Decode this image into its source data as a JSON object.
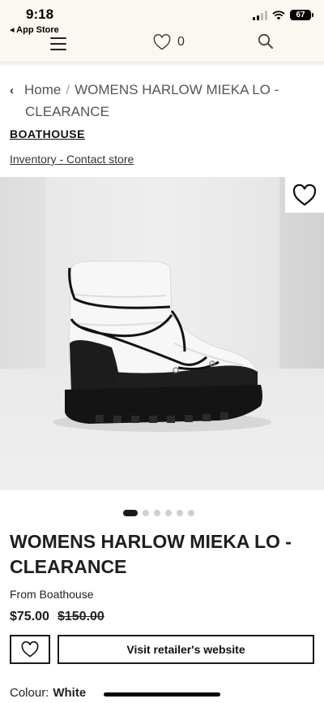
{
  "status_bar": {
    "time": "9:18",
    "back_label": "◂ App Store",
    "battery": "67"
  },
  "header": {
    "menu_icon": "hamburger-menu-icon",
    "wishlist_icon": "heart-icon",
    "wishlist_count": "0",
    "search_icon": "search-icon"
  },
  "breadcrumb": {
    "home": "Home",
    "separator": "/",
    "current_line1": "WOMENS HARLOW MIEKA LO -",
    "current_line2": "CLEARANCE"
  },
  "store": {
    "name": "BOATHOUSE",
    "inventory_link": "Inventory - Contact store"
  },
  "gallery": {
    "image_alt": "White puffer snow boot with black platform sole and black laces",
    "dot_count": 6,
    "active_index": 0
  },
  "product": {
    "title": "WOMENS HARLOW MIEKA LO - CLEARANCE",
    "from": "From Boathouse",
    "price": "$75.00",
    "original_price": "$150.00",
    "visit_button": "Visit retailer's website",
    "colour_label": "Colour:",
    "colour_value": "White"
  },
  "colors": {
    "header_bg": "#fbf7f1",
    "text": "#1a1a1a"
  }
}
